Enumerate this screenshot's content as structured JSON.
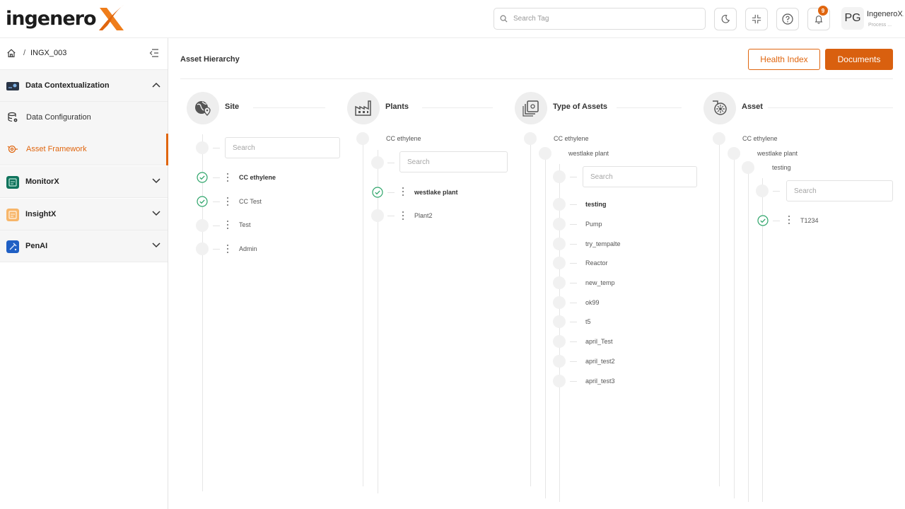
{
  "app": {
    "logo_text": "ingenero",
    "logo_mark": "X",
    "colors": {
      "accent": "#e0660f",
      "accent_dark": "#d9600f",
      "check": "#2fa56b"
    }
  },
  "topbar": {
    "search_placeholder": "Search Tag",
    "icons": [
      "moon-icon",
      "fullscreen-exit-icon",
      "help-icon",
      "bell-icon"
    ],
    "notification_count": "9",
    "user": {
      "initials": "PG",
      "name": "IngeneroX...",
      "role": "Process ..."
    }
  },
  "sidebar": {
    "breadcrumb": {
      "separator": "/",
      "current": "INGX_003"
    },
    "sections": [
      {
        "label": "Data Contextualization",
        "icon": "data-context-icon",
        "expanded": true,
        "items": [
          {
            "label": "Data Configuration",
            "icon": "database-gear-icon",
            "active": false
          },
          {
            "label": "Asset Framework",
            "icon": "asset-framework-icon",
            "active": true
          }
        ]
      },
      {
        "label": "MonitorX",
        "icon": "monitorx-icon",
        "expanded": false
      },
      {
        "label": "InsightX",
        "icon": "insightx-icon",
        "expanded": false
      },
      {
        "label": "PenAI",
        "icon": "penai-icon",
        "expanded": false
      }
    ]
  },
  "main": {
    "title": "Asset Hierarchy",
    "buttons": {
      "health_index": "Health Index",
      "documents": "Documents"
    },
    "columns": {
      "site": {
        "title": "Site",
        "search_placeholder": "Search",
        "items": [
          {
            "label": "CC ethylene",
            "checked": true,
            "bold": true
          },
          {
            "label": "CC Test",
            "checked": true,
            "bold": false
          },
          {
            "label": "Test",
            "checked": false,
            "bold": false
          },
          {
            "label": "Admin",
            "checked": false,
            "bold": false
          }
        ]
      },
      "plants": {
        "title": "Plants",
        "path": [
          "CC ethylene"
        ],
        "search_placeholder": "Search",
        "items": [
          {
            "label": "westlake plant",
            "checked": true,
            "bold": true
          },
          {
            "label": "Plant2",
            "checked": false,
            "bold": false
          }
        ]
      },
      "types": {
        "title": "Type of Assets",
        "path": [
          "CC ethylene",
          "westlake plant"
        ],
        "search_placeholder": "Search",
        "items": [
          {
            "label": "testing",
            "bold": true
          },
          {
            "label": "Pump",
            "bold": false
          },
          {
            "label": "try_tempalte",
            "bold": false
          },
          {
            "label": "Reactor",
            "bold": false
          },
          {
            "label": "new_temp",
            "bold": false
          },
          {
            "label": "ok99",
            "bold": false
          },
          {
            "label": "t5",
            "bold": false
          },
          {
            "label": "april_Test",
            "bold": false
          },
          {
            "label": "april_test2",
            "bold": false
          },
          {
            "label": "april_test3",
            "bold": false
          }
        ]
      },
      "asset": {
        "title": "Asset",
        "path": [
          "CC ethylene",
          "westlake plant",
          "testing"
        ],
        "search_placeholder": "Search",
        "items": [
          {
            "label": "T1234",
            "checked": true,
            "bold": false
          }
        ]
      }
    }
  }
}
